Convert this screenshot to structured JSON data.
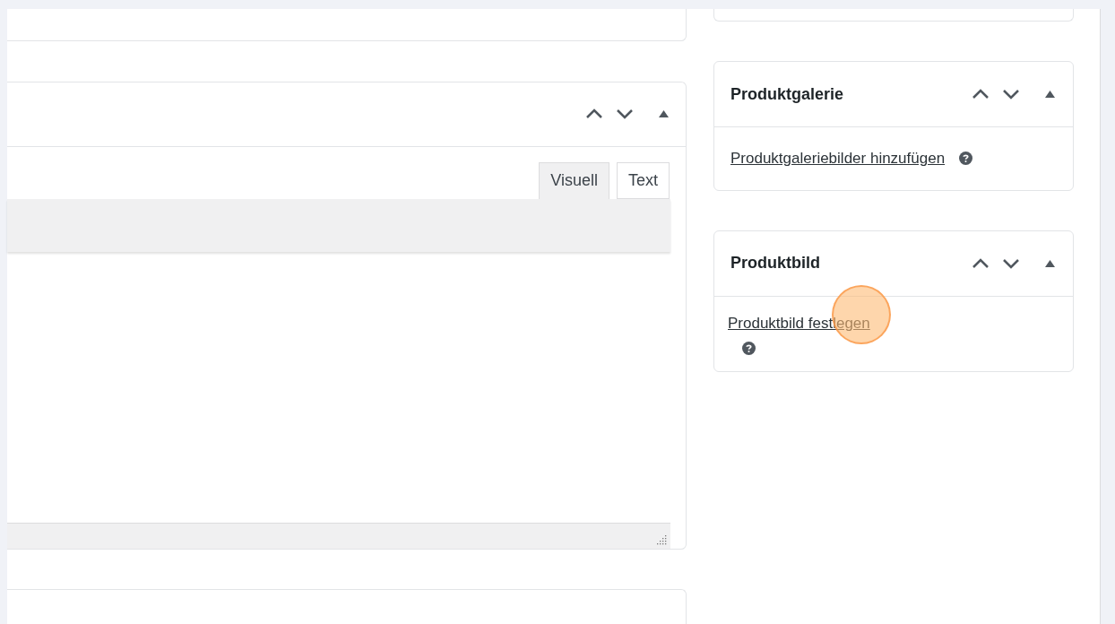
{
  "editor": {
    "tabs": [
      {
        "label": "Visuell",
        "selected": true
      },
      {
        "label": "Text",
        "selected": false
      }
    ]
  },
  "sidebar": [
    {
      "title": "Produktgalerie",
      "link": "Produktgaleriebilder hinzufügen",
      "help_wrapped": false
    },
    {
      "title": "Produktbild",
      "link": "Produktbild festlegen",
      "help_wrapped": true
    }
  ]
}
